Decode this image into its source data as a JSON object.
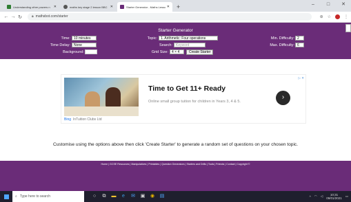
{
  "browser": {
    "tabs": [
      {
        "title": "Understanding other powers n",
        "active": false,
        "color": "#2e7d32"
      },
      {
        "title": "maths key stage 2 lesson BBC",
        "active": false,
        "color": "#555555"
      },
      {
        "title": "Starter Generator - Maths Lesso",
        "active": true,
        "color": "#6a2c78"
      }
    ],
    "new_tab": "+",
    "url": "mathsbot.com/starter",
    "window_controls": [
      "–",
      "□",
      "✕"
    ]
  },
  "header": {
    "title": "Starter Generator",
    "time_label": "Time:",
    "time_value": "10 minutes",
    "delay_label": "Time Delay:",
    "delay_value": "None",
    "background_label": "Background:",
    "topic_label": "Topic:",
    "topic_value": "1. Arithmetic: Four operations",
    "search_label": "Search:",
    "search_placeholder": "Keyword",
    "grid_label": "Grid Size:",
    "grid_value": "4 × 4",
    "starter_button": "Create Starter",
    "min_label": "Min. Difficulty:",
    "min_value": "2",
    "max_label": "Max. Difficulty:",
    "max_value": "6"
  },
  "ad": {
    "headline": "Time to Get 11+ Ready",
    "body": "Online small group tuition for children in Years 3, 4 & 5.",
    "brand_prefix": "Bing",
    "brand": "InTuition Clubs Ltd",
    "arrow": "›",
    "adchoices": "▷ ✕"
  },
  "instructions": "Customise using the options above then click 'Create Starter' to generate a random set of questions on your chosen topic.",
  "footer": {
    "links": "Home | GCSE Resources | Manipulatives | Printables | Question Generators | Starters and Drills | Tools | Friends | Contact | Copyright ©"
  },
  "taskbar": {
    "search_placeholder": "Type here to search",
    "time": "10:31",
    "date": "09/01/2021"
  },
  "colors": {
    "header_bg": "#6a2c78",
    "footer_bg": "#6a2c78"
  }
}
